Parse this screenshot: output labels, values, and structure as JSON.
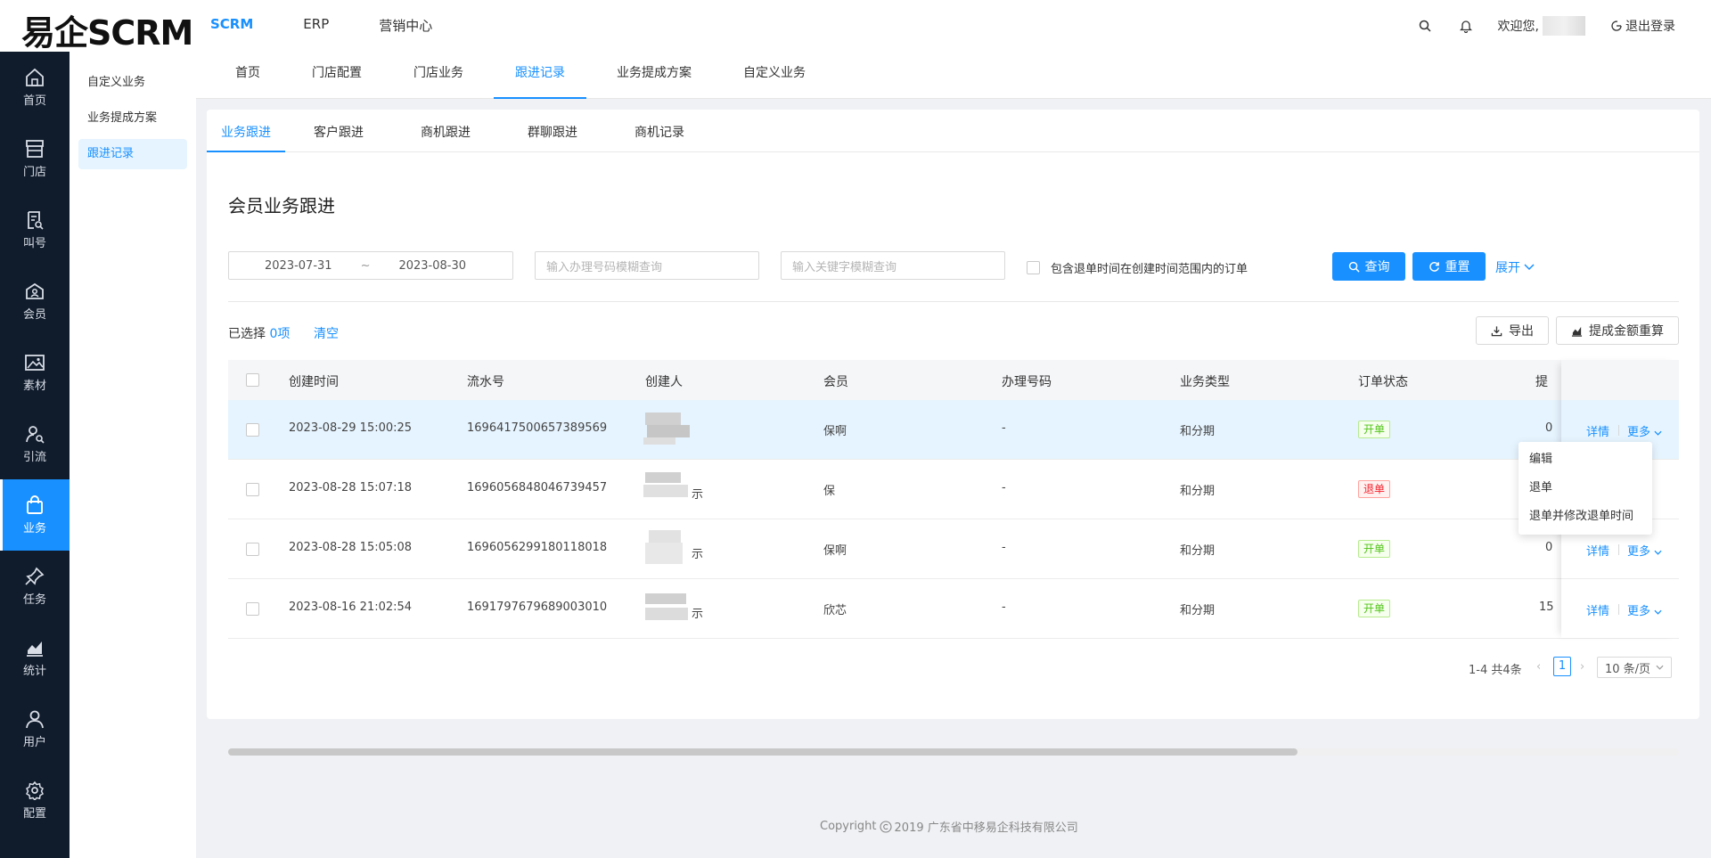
{
  "app": {
    "logo": "易企SCRM"
  },
  "topnav": [
    {
      "label": "SCRM",
      "active": true
    },
    {
      "label": "ERP",
      "active": false
    },
    {
      "label": "营销中心",
      "active": false
    }
  ],
  "header": {
    "welcome": "欢迎您,",
    "logout": "退出登录"
  },
  "sidebar": [
    {
      "label": "首页",
      "icon": "home-icon"
    },
    {
      "label": "门店",
      "icon": "store-icon"
    },
    {
      "label": "叫号",
      "icon": "queue-icon"
    },
    {
      "label": "会员",
      "icon": "member-icon"
    },
    {
      "label": "素材",
      "icon": "image-icon"
    },
    {
      "label": "引流",
      "icon": "traffic-icon"
    },
    {
      "label": "业务",
      "icon": "bag-icon",
      "active": true
    },
    {
      "label": "任务",
      "icon": "pin-icon"
    },
    {
      "label": "统计",
      "icon": "chart-icon"
    },
    {
      "label": "用户",
      "icon": "user-icon"
    },
    {
      "label": "配置",
      "icon": "gear-icon"
    }
  ],
  "subsidebar": [
    {
      "label": "自定义业务"
    },
    {
      "label": "业务提成方案"
    },
    {
      "label": "跟进记录",
      "active": true
    }
  ],
  "secnav": [
    {
      "label": "首页"
    },
    {
      "label": "门店配置"
    },
    {
      "label": "门店业务"
    },
    {
      "label": "跟进记录",
      "active": true
    },
    {
      "label": "业务提成方案"
    },
    {
      "label": "自定义业务"
    }
  ],
  "subtabs": [
    {
      "label": "业务跟进",
      "active": true
    },
    {
      "label": "客户跟进"
    },
    {
      "label": "商机跟进"
    },
    {
      "label": "群聊跟进"
    },
    {
      "label": "商机记录"
    }
  ],
  "page": {
    "title": "会员业务跟进"
  },
  "filters": {
    "date_start": "2023-07-31",
    "date_sep": "~",
    "date_end": "2023-08-30",
    "number_placeholder": "输入办理号码模糊查询",
    "keyword_placeholder": "输入关键字模糊查询",
    "include_refund_label": "包含退单时间在创建时间范围内的订单",
    "query_label": "查询",
    "reset_label": "重置",
    "expand_label": "展开"
  },
  "selection": {
    "prefix": "已选择 ",
    "count": "0项",
    "clear": "清空"
  },
  "toolbar": {
    "export_label": "导出",
    "recalc_label": "提成金额重算"
  },
  "table": {
    "columns": [
      "创建时间",
      "流水号",
      "创建人",
      "会员",
      "办理号码",
      "业务类型",
      "订单状态",
      "提"
    ],
    "rows": [
      {
        "time": "2023-08-29 15:00:25",
        "serial": "1696417500657389569",
        "creator_suffix": "",
        "member": "保啊",
        "number": "-",
        "type": "和分期",
        "status": "开单",
        "status_kind": "open",
        "commission": "0",
        "highlighted": true
      },
      {
        "time": "2023-08-28 15:07:18",
        "serial": "1696056848046739457",
        "creator_suffix": "示",
        "member": "保",
        "number": "-",
        "type": "和分期",
        "status": "退单",
        "status_kind": "refund",
        "commission": "",
        "highlighted": false
      },
      {
        "time": "2023-08-28 15:05:08",
        "serial": "1696056299180118018",
        "creator_suffix": "示",
        "member": "保啊",
        "number": "-",
        "type": "和分期",
        "status": "开单",
        "status_kind": "open",
        "commission": "0",
        "highlighted": false
      },
      {
        "time": "2023-08-16 21:02:54",
        "serial": "1691797679689003010",
        "creator_suffix": "示",
        "member": "欣芯",
        "number": "-",
        "type": "和分期",
        "status": "开单",
        "status_kind": "open",
        "commission": "15",
        "highlighted": false
      }
    ],
    "action_detail": "详情",
    "action_more": "更多"
  },
  "dropdown": {
    "items": [
      "编辑",
      "退单",
      "退单并修改退单时间"
    ]
  },
  "pagination": {
    "summary": "1-4 共4条",
    "current": "1",
    "page_size": "10 条/页"
  },
  "footer": {
    "copyright": "Copyright",
    "text": "2019 广东省中移易企科技有限公司"
  },
  "colors": {
    "primary": "#1890ff",
    "sidebar_bg": "#101c2c",
    "open_tag": "#52c41a",
    "refund_tag": "#f5222d"
  }
}
